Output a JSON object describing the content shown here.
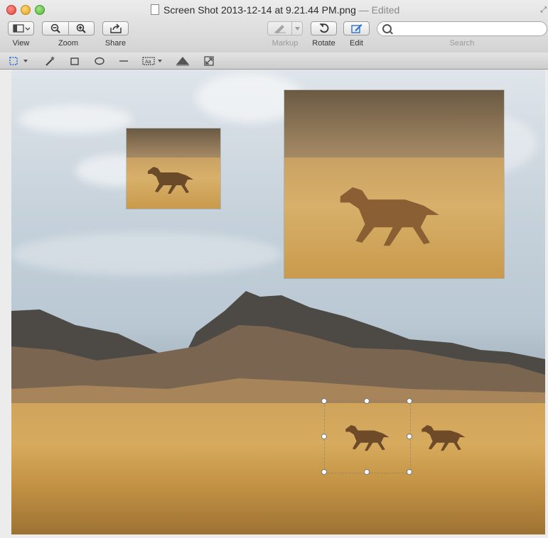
{
  "window": {
    "title": "Screen Shot 2013-12-14 at 9.21.44 PM.png",
    "title_suffix": " — Edited"
  },
  "toolbar": {
    "view_label": "View",
    "zoom_label": "Zoom",
    "share_label": "Share",
    "markup_label": "Markup",
    "rotate_label": "Rotate",
    "edit_label": "Edit",
    "search_label": "Search",
    "search_placeholder": ""
  },
  "markup_tools": [
    "rectangular-selection",
    "instant-alpha",
    "rectangle-shape",
    "oval-shape",
    "line-shape",
    "text-box",
    "adjust-color",
    "adjust-size"
  ],
  "icons": {
    "view": "sidebar-icon",
    "zoom_out": "zoom-out-icon",
    "zoom_in": "zoom-in-icon",
    "share": "share-icon",
    "markup": "pen-icon",
    "rotate": "rotate-icon",
    "edit": "edit-pencil-icon",
    "search": "search-icon"
  },
  "colors": {
    "edit_accent": "#2a6fd6",
    "close": "#e0443e",
    "minimize": "#e0a123",
    "maximize": "#4fb834"
  }
}
